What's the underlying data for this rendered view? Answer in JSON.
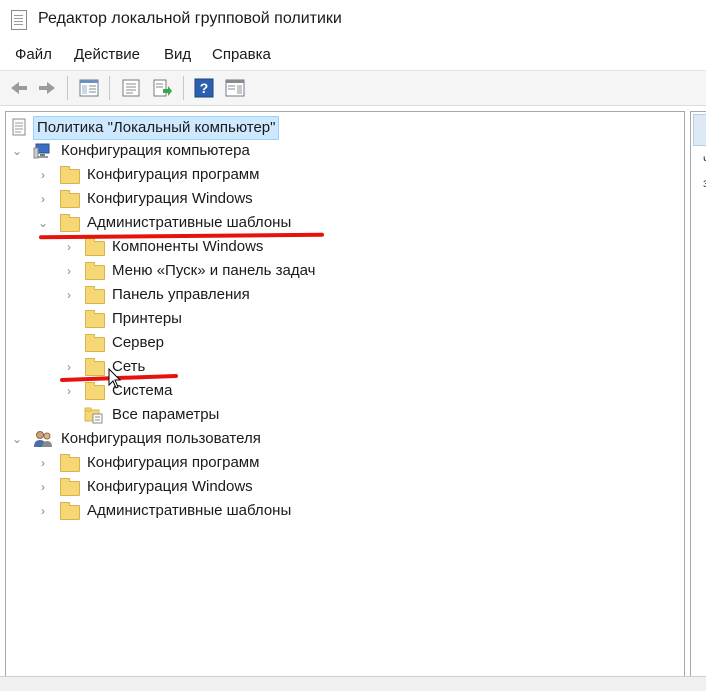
{
  "window": {
    "title": "Редактор локальной групповой политики"
  },
  "menu": [
    "Файл",
    "Действие",
    "Вид",
    "Справка"
  ],
  "toolbar": {
    "buttons": [
      "back-arrow-icon",
      "forward-arrow-icon",
      "show-hide-tree-icon",
      "properties-icon",
      "export-list-icon",
      "help-icon",
      "show-hide-action-pane-icon"
    ],
    "help_glyph": "?"
  },
  "tree": {
    "root": "Политика \"Локальный компьютер\"",
    "computer_config": {
      "label": "Конфигурация компьютера",
      "software": "Конфигурация программ",
      "windows": "Конфигурация Windows",
      "admin_templates": {
        "label": "Административные шаблоны",
        "children": {
          "windows_components": "Компоненты Windows",
          "start_menu": "Меню «Пуск» и панель задач",
          "control_panel": "Панель управления",
          "printers": "Принтеры",
          "server": "Сервер",
          "network": "Сеть",
          "system": "Система",
          "all_settings": "Все параметры"
        }
      }
    },
    "user_config": {
      "label": "Конфигурация пользователя",
      "software": "Конфигурация программ",
      "windows": "Конфигурация Windows",
      "admin_templates": "Административные шаблоны"
    }
  },
  "right_pane": {
    "line1": "ч",
    "line2": "з"
  },
  "annotation_color": "#e8120c"
}
